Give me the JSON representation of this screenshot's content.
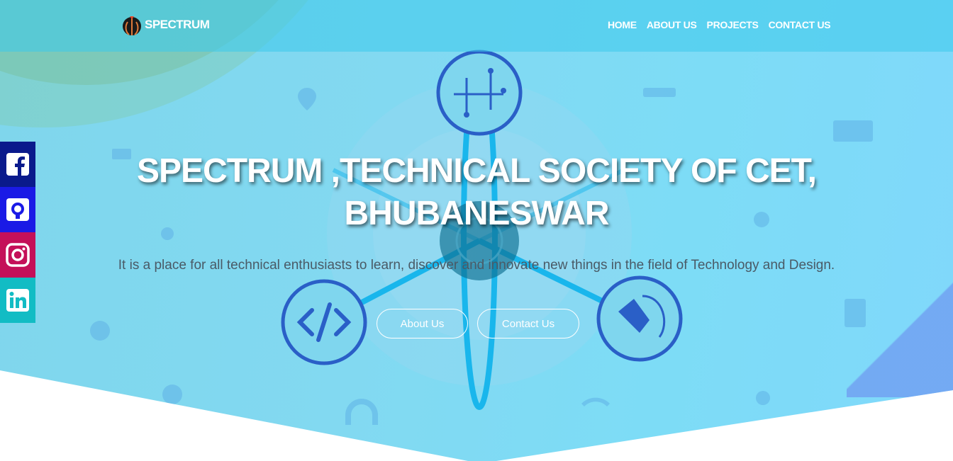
{
  "header": {
    "brand": "SPECTRUM",
    "nav": [
      {
        "label": "HOME"
      },
      {
        "label": "ABOUT US"
      },
      {
        "label": "PROJECTS"
      },
      {
        "label": "CONTACT US"
      }
    ]
  },
  "hero": {
    "title": "SPECTRUM ,TECHNICAL SOCIETY OF CET, BHUBANESWAR",
    "description": "It is a place for all technical enthusiasts to learn, discover and innovate new things in the field of Technology and Design.",
    "buttons": {
      "about": "About Us",
      "contact": "Contact Us"
    }
  },
  "social": [
    {
      "name": "facebook-icon"
    },
    {
      "name": "github-icon"
    },
    {
      "name": "instagram-icon"
    },
    {
      "name": "linkedin-icon"
    }
  ],
  "colors": {
    "facebook": "#0a1a8c",
    "github": "#1a1ae6",
    "instagram": "#c41059",
    "linkedin": "#12bcc4",
    "hero_bg": "#82d9f1",
    "graphic_blue": "#2a5fc7"
  }
}
